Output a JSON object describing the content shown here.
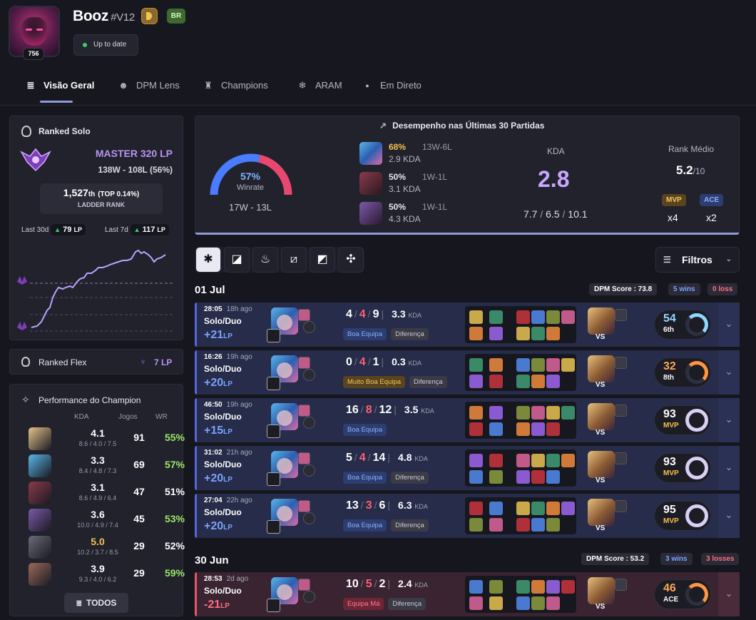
{
  "profile": {
    "name": "Booz",
    "tag": "#V12",
    "level": "756",
    "region": "BR",
    "status": "Up to date"
  },
  "tabs": [
    {
      "label": "Visão Geral",
      "icon": "≣"
    },
    {
      "label": "DPM Lens",
      "icon": "☻"
    },
    {
      "label": "Champions",
      "icon": "♜"
    },
    {
      "label": "ARAM",
      "icon": "❄"
    },
    {
      "label": "Em Direto",
      "icon": "●"
    }
  ],
  "ranked_solo": {
    "title": "Ranked Solo",
    "tier": "MASTER 320 LP",
    "record": "138W - 108L (56%)",
    "ladder_rank": "1,527",
    "ladder_suffix": "th",
    "top_pct": "(TOP 0.14%)",
    "ladder_label": "LADDER RANK",
    "last30_label": "Last 30d",
    "last30_lp": "79",
    "last7_label": "Last 7d",
    "last7_lp": "117",
    "lp_unit": "LP"
  },
  "ranked_flex": {
    "title": "Ranked Flex",
    "lp": "7 LP"
  },
  "champ_perf": {
    "title": "Performance do Champion",
    "headers": [
      "KDA",
      "Jogos",
      "WR"
    ],
    "button": "TODOS",
    "rows": [
      {
        "kda": "4.1",
        "detail": "8.6 / 4.0 / 7.5",
        "games": "91",
        "wr": "55%",
        "color": "#e6c28a",
        "kda_color": "#ffffff",
        "wr_color": "#9be76a"
      },
      {
        "kda": "3.3",
        "detail": "8.4 / 4.8 / 7.3",
        "games": "69",
        "wr": "57%",
        "color": "#5ab5e8",
        "kda_color": "#ffffff",
        "wr_color": "#9be76a"
      },
      {
        "kda": "3.1",
        "detail": "8.6 / 4.9 / 6.4",
        "games": "47",
        "wr": "51%",
        "color": "#8a3a4a",
        "kda_color": "#ffffff",
        "wr_color": "#ffffff"
      },
      {
        "kda": "3.6",
        "detail": "10.0 / 4.9 / 7.4",
        "games": "45",
        "wr": "53%",
        "color": "#7a5aa8",
        "kda_color": "#ffffff",
        "wr_color": "#9be76a"
      },
      {
        "kda": "5.0",
        "detail": "10.2 / 3.7 / 8.5",
        "games": "29",
        "wr": "52%",
        "color": "#6a6a7a",
        "kda_color": "#f4c24f",
        "wr_color": "#ffffff"
      },
      {
        "kda": "3.9",
        "detail": "9.3 / 4.0 / 6.2",
        "games": "29",
        "wr": "59%",
        "color": "#9a6a5a",
        "kda_color": "#ffffff",
        "wr_color": "#9be76a"
      }
    ]
  },
  "summary": {
    "title": "Desempenho nas Últimas 30 Partidas",
    "winrate": "57%",
    "winrate_label": "Winrate",
    "record": "17W - 13L",
    "winrate_value": 57,
    "champs": [
      {
        "pct": "68%",
        "rec": "13W-6L",
        "kda": "2.9 KDA",
        "hl": true
      },
      {
        "pct": "50%",
        "rec": "1W-1L",
        "kda": "3.1 KDA",
        "hl": false
      },
      {
        "pct": "50%",
        "rec": "1W-1L",
        "kda": "4.3 KDA",
        "hl": false
      }
    ],
    "kda_label": "KDA",
    "kda": "2.8",
    "kda_k": "7.7",
    "kda_d": "6.5",
    "kda_a": "10.1",
    "rank_label": "Rank Médio",
    "rank": "5.2",
    "rank_of": "/10",
    "mvp_label": "MVP",
    "mvp": "x4",
    "ace_label": "ACE",
    "ace": "x2"
  },
  "filters": {
    "label": "Filtros"
  },
  "days": [
    {
      "date": "01 Jul",
      "dpm": "DPM Score : 73.8",
      "wins": "5 wins",
      "losses": "0 loss"
    },
    {
      "date": "30 Jun",
      "dpm": "DPM Score : 53.2",
      "wins": "3 wins",
      "losses": "3 losses"
    }
  ],
  "games": [
    {
      "result": "win",
      "time": "28:05",
      "ago": "18h ago",
      "queue": "Solo/Duo",
      "lp": "+21",
      "lp_unit": "LP",
      "k": "4",
      "d": "4",
      "a": "9",
      "ratio": "3.3",
      "kda_unit": "KDA",
      "tag1": "Boa Equipa",
      "tag1c": "blue",
      "tag2": "Diferença",
      "score": "54",
      "place": "6th",
      "style": "blue"
    },
    {
      "result": "win",
      "time": "16:26",
      "ago": "19h ago",
      "queue": "Solo/Duo",
      "lp": "+20",
      "lp_unit": "LP",
      "k": "0",
      "d": "4",
      "a": "1",
      "ratio": "0.3",
      "kda_unit": "KDA",
      "tag1": "Muito Boa Equipa",
      "tag1c": "gold",
      "tag2": "Diferença",
      "score": "32",
      "place": "8th",
      "style": "orange"
    },
    {
      "result": "win",
      "time": "46:50",
      "ago": "19h ago",
      "queue": "Solo/Duo",
      "lp": "+15",
      "lp_unit": "LP",
      "k": "16",
      "d": "8",
      "a": "12",
      "ratio": "3.5",
      "kda_unit": "KDA",
      "tag1": "Boa Equipa",
      "tag1c": "blue",
      "tag2": "",
      "score": "93",
      "place": "MVP",
      "style": "mvp"
    },
    {
      "result": "win",
      "time": "31:02",
      "ago": "21h ago",
      "queue": "Solo/Duo",
      "lp": "+20",
      "lp_unit": "LP",
      "k": "5",
      "d": "4",
      "a": "14",
      "ratio": "4.8",
      "kda_unit": "KDA",
      "tag1": "Boa Equipa",
      "tag1c": "blue",
      "tag2": "Diferença",
      "score": "93",
      "place": "MVP",
      "style": "mvp"
    },
    {
      "result": "win",
      "time": "27:04",
      "ago": "22h ago",
      "queue": "Solo/Duo",
      "lp": "+20",
      "lp_unit": "LP",
      "k": "13",
      "d": "3",
      "a": "6",
      "ratio": "6.3",
      "kda_unit": "KDA",
      "tag1": "Boa Equipa",
      "tag1c": "blue",
      "tag2": "Diferença",
      "score": "95",
      "place": "MVP",
      "style": "mvp"
    },
    {
      "result": "loss",
      "time": "28:53",
      "ago": "2d ago",
      "queue": "Solo/Duo",
      "lp": "-21",
      "lp_unit": "LP",
      "k": "10",
      "d": "5",
      "a": "2",
      "ratio": "2.4",
      "kda_unit": "KDA",
      "tag1": "Equipa Má",
      "tag1c": "red",
      "tag2": "Diferença",
      "score": "46",
      "place": "ACE",
      "style": "orange"
    }
  ],
  "vs_label": "VS",
  "colors": {
    "accent": "#8f9ad8",
    "win": "#5468e0",
    "loss": "#e85866",
    "master": "#b993f2"
  }
}
